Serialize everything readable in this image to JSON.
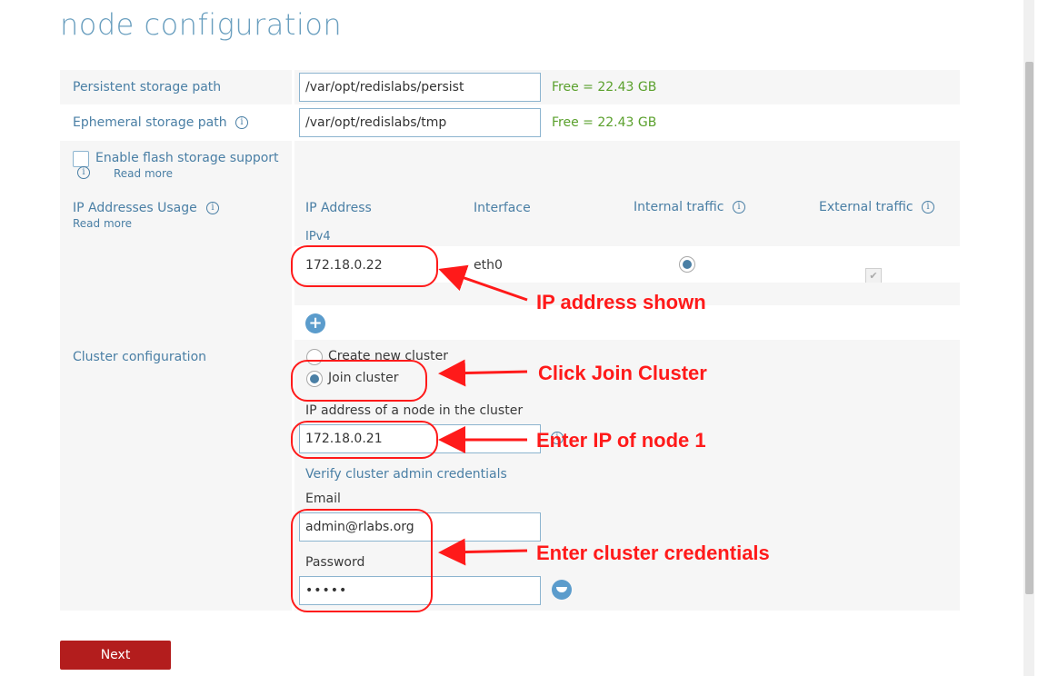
{
  "page": {
    "title": "node configuration"
  },
  "storage": {
    "persistent": {
      "label": "Persistent storage path",
      "value": "/var/opt/redislabs/persist",
      "free": "Free = 22.43 GB"
    },
    "ephemeral": {
      "label": "Ephemeral storage path",
      "value": "/var/opt/redislabs/tmp",
      "free": "Free = 22.43 GB"
    },
    "flash": {
      "label": "Enable flash storage support",
      "read_more": "Read more"
    }
  },
  "ip_usage": {
    "label": "IP Addresses Usage",
    "read_more": "Read more",
    "headers": {
      "ip": "IP Address",
      "interface": "Interface",
      "internal": "Internal traffic",
      "external": "External traffic"
    },
    "group": "IPv4",
    "row": {
      "ip": "172.18.0.22",
      "interface": "eth0"
    }
  },
  "cluster": {
    "label": "Cluster configuration",
    "create_option": "Create new cluster",
    "join_option": "Join cluster",
    "node_ip_label": "IP address of a node in the cluster",
    "node_ip_value": "172.18.0.21",
    "verify_label": "Verify cluster admin credentials",
    "email_label": "Email",
    "email_value": "admin@rlabs.org",
    "password_label": "Password",
    "password_value": "•••••"
  },
  "actions": {
    "next": "Next"
  },
  "annotations": {
    "ip_shown": "IP address shown",
    "click_join": "Click Join Cluster",
    "enter_ip": "Enter IP of node 1",
    "enter_credentials": "Enter cluster credentials"
  },
  "colors": {
    "accent": "#4a7fa5",
    "free_text": "#5aa02c",
    "next_button": "#b31d1d",
    "annotation": "#ff1a1a"
  }
}
